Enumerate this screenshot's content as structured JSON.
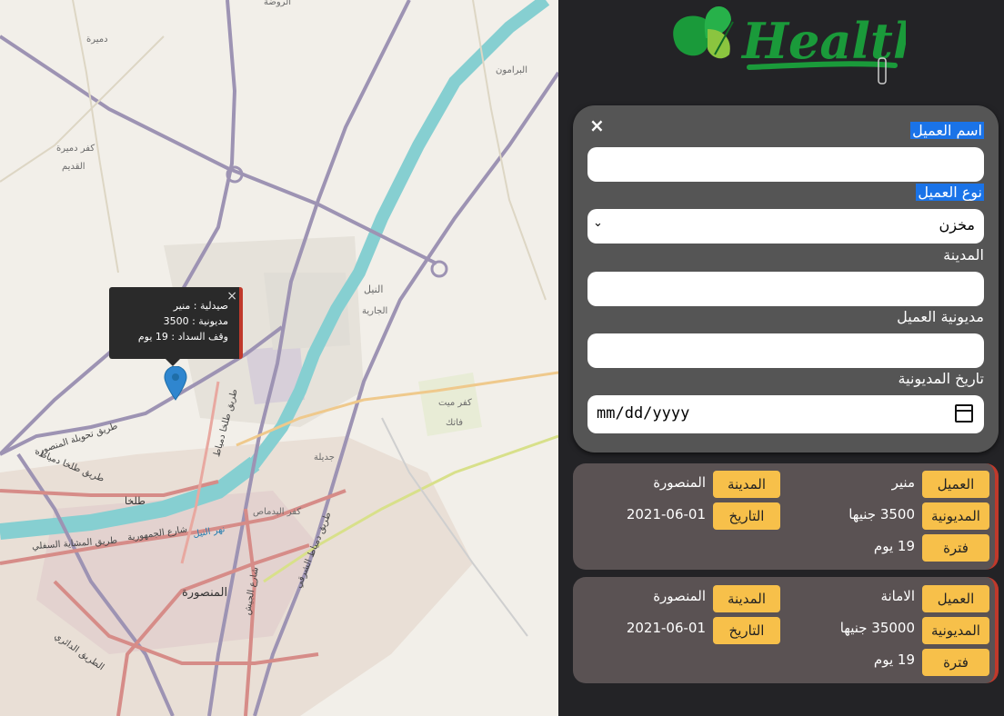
{
  "map": {
    "popup": {
      "line1": "صيدلية : منير",
      "line2": "مديونية : 3500",
      "line3": "وقف السداد : 19 يوم",
      "close": "×"
    },
    "labels": {
      "mansoura": "المنصورة",
      "talkha": "طلخا",
      "nile": "النيل",
      "kafr_demira": "كفر دميرة",
      "qadim": "القديم",
      "damira": "دميرة",
      "bermon": "البرامون",
      "kafr_mit": "كفر ميت",
      "fatek": "فاتك",
      "gadila": "جديلة",
      "kafr_badamas": "كفر البدماص",
      "gareya": "الجارية",
      "road_talkha": "طريق طلخا دمياط",
      "road_mansoura_bypass": "طريق تحويلة المنصورة",
      "road_gomhoreya": "شارع الجمهورية",
      "road_mashaya": "طريق المشاية السفلي",
      "road_geish": "شارع الجيش",
      "road_daery": "الطريق الدائري",
      "road_sharqi": "طريق دمياط الشرقي",
      "road_batr": "طريق طلخا دمياط",
      "nile_river": "نهر النيل",
      "rawda": "الروضة"
    }
  },
  "logo": {
    "text": "Healthy"
  },
  "form": {
    "close": "×",
    "customer_name_label": "اسم العميل",
    "customer_name_value": "",
    "customer_type_label": "نوع العميل",
    "customer_type_value": "مخزن",
    "city_label": "المدينة",
    "city_value": "",
    "debt_label": "مديونية العميل",
    "debt_value": "",
    "debt_date_label": "تاريخ المديونية",
    "debt_date_placeholder": "mm/dd/yyyy"
  },
  "cards": [
    {
      "customer_tag": "العميل",
      "customer": "منير",
      "city_tag": "المدينة",
      "city": "المنصورة",
      "debt_tag": "المديونية",
      "debt": "3500 جنيها",
      "date_tag": "التاريخ",
      "date": "2021-06-01",
      "period_tag": "فترة",
      "period": "19 يوم"
    },
    {
      "customer_tag": "العميل",
      "customer": "الامانة",
      "city_tag": "المدينة",
      "city": "المنصورة",
      "debt_tag": "المديونية",
      "debt": "35000 جنيها",
      "date_tag": "التاريخ",
      "date": "2021-06-01",
      "period_tag": "فترة",
      "period": "19 يوم"
    }
  ],
  "colors": {
    "tag": "#f7c04a",
    "accent": "#c0392b",
    "panel": "#555555",
    "card": "#5a5253",
    "highlight": "#1a73e8"
  }
}
